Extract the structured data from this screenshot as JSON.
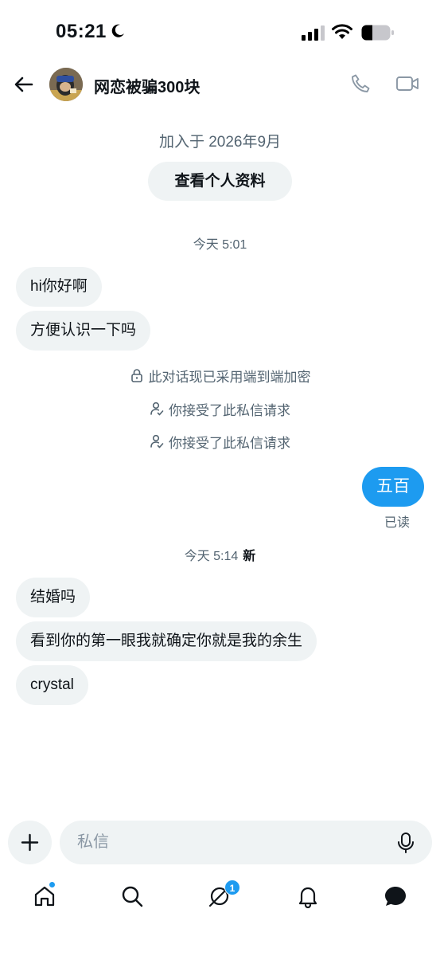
{
  "status_bar": {
    "time": "05:21",
    "icons": [
      "moon-icon",
      "signal-icon",
      "wifi-icon",
      "battery-icon"
    ]
  },
  "header": {
    "title": "网恋被骗300块",
    "icons": [
      "back-arrow-icon",
      "phone-icon",
      "video-icon"
    ]
  },
  "profile": {
    "joined": "加入于 2026年9月",
    "view_profile_label": "查看个人资料"
  },
  "conversation": {
    "timestamp_1": "今天 5:01",
    "incoming_1": [
      "hi你好啊",
      "方便认识一下吗"
    ],
    "system_notes": [
      {
        "icon": "lock-icon",
        "text": "此对话现已采用端到端加密"
      },
      {
        "icon": "person-check-icon",
        "text": "你接受了此私信请求"
      },
      {
        "icon": "person-check-icon",
        "text": "你接受了此私信请求"
      }
    ],
    "outgoing": {
      "text": "五百",
      "status": "已读"
    },
    "timestamp_2": "今天 5:14",
    "new_label": "新",
    "incoming_2": [
      "结婚吗",
      "看到你的第一眼我就确定你就是我的余生",
      "crystal"
    ]
  },
  "composer": {
    "placeholder": "私信",
    "icons": [
      "plus-icon",
      "mic-icon"
    ]
  },
  "bottom_nav": {
    "items": [
      "home-icon",
      "search-icon",
      "spaces-icon",
      "notifications-icon",
      "messages-icon"
    ],
    "badge_count": "1"
  },
  "colors": {
    "accent": "#1d9bf0",
    "bubble_gray": "#eff3f4",
    "secondary_text": "#536471"
  }
}
